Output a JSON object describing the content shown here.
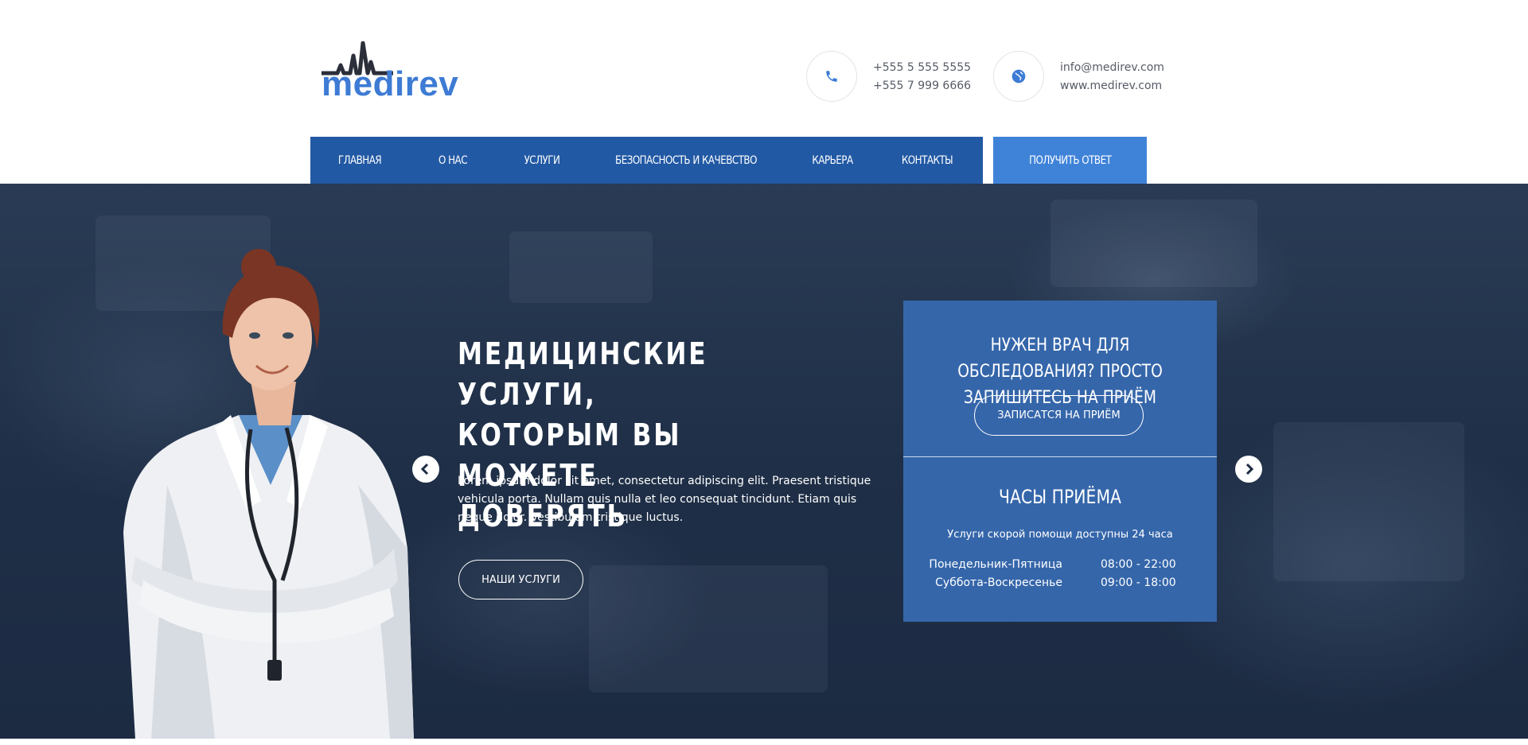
{
  "brand": {
    "name": "medirev",
    "accent_color": "#3d7bd4",
    "dark_color": "#2a2f3a"
  },
  "contacts": {
    "phone": {
      "icon": "phone-icon",
      "lines": [
        "+555 5 555 5555",
        "+555 7 999 6666"
      ]
    },
    "web": {
      "icon": "globe-icon",
      "lines": [
        "info@medirev.com",
        "www.medirev.com"
      ]
    }
  },
  "nav": {
    "items": [
      {
        "label": "ГЛАВНАЯ"
      },
      {
        "label": "О НАС"
      },
      {
        "label": "УСЛУГИ"
      },
      {
        "label": "БЕЗОПАСНОСТЬ И КАЧЕВСТВО"
      },
      {
        "label": "КАРЬЕРА"
      },
      {
        "label": "КОНТАКТЫ"
      }
    ],
    "cta_label": "ПОЛУЧИТЬ ОТВЕТ",
    "bar_color": "#2259a4",
    "cta_color": "#3f83d9"
  },
  "hero": {
    "title": "МЕДИЦИНСКИЕ УСЛУГИ, КОТОРЫМ ВЫ МОЖЕТЕ ДОВЕРЯТЬ",
    "text": "Lorem ipsum dolor sit amet, consectetur adipiscing elit. Praesent tristique vehicula porta. Nullam quis nulla et leo consequat tincidunt. Etiam quis neque dolor. Vestibulum tristique luctus.",
    "button_label": "НАШИ УСЛУГИ",
    "prev_icon": "chevron-left-icon",
    "next_icon": "chevron-right-icon"
  },
  "appointment": {
    "title": "НУЖЕН ВРАЧ ДЛЯ ОБСЛЕДОВАНИЯ? ПРОСТО ЗАПИШИТЕСЬ НА ПРИЁМ",
    "button_label": "ЗАПИСАТСЯ НА ПРИЁМ",
    "hours_title": "ЧАСЫ ПРИЁМА",
    "hours_note": "Услуги скорой помощи доступны 24 часа",
    "hours": [
      {
        "days": "Понедельник-Пятница",
        "time": "08:00 - 22:00"
      },
      {
        "days": "Суббота-Воскресенье",
        "time": "09:00 - 18:00"
      }
    ],
    "panel_color": "#3566aa"
  }
}
